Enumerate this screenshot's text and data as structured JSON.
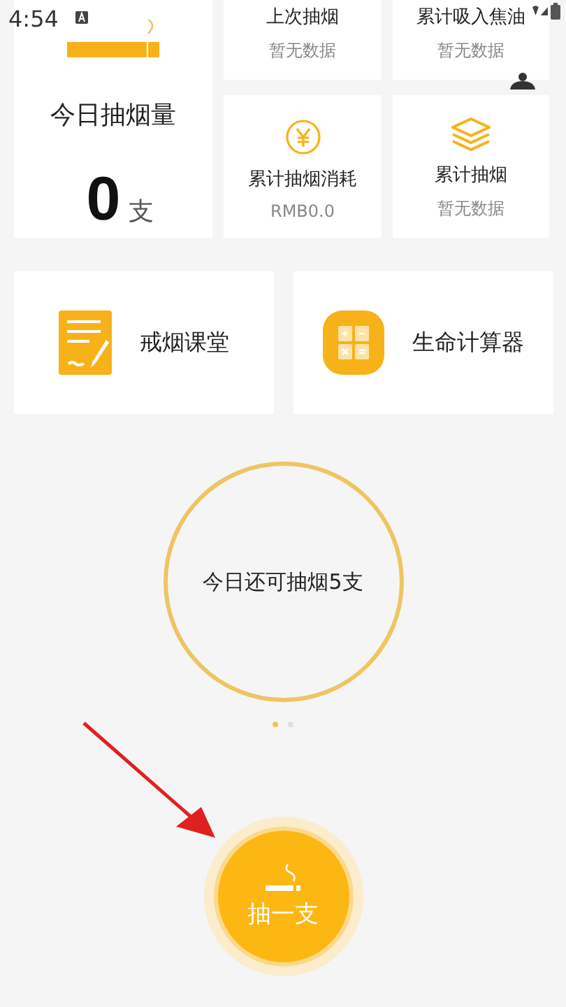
{
  "status_bar": {
    "time": "4:54"
  },
  "today": {
    "label": "今日抽烟量",
    "count": "0",
    "unit": "支"
  },
  "stats": [
    {
      "kind": "text",
      "title": "上次抽烟",
      "value": "暂无数据"
    },
    {
      "kind": "text",
      "title": "累计吸入焦油",
      "value": "暂无数据"
    },
    {
      "kind": "money",
      "title": "累计抽烟消耗",
      "value": "RMB0.0"
    },
    {
      "kind": "layers",
      "title": "累计抽烟",
      "value": "暂无数据"
    }
  ],
  "shortcuts": [
    {
      "kind": "notes",
      "label": "戒烟课堂"
    },
    {
      "kind": "calculator",
      "label": "生命计算器"
    }
  ],
  "remaining": {
    "text": "今日还可抽烟5支"
  },
  "pager": [
    {
      "selected": true
    },
    {
      "selected": false
    }
  ],
  "smoke_button": {
    "label": "抽一支"
  }
}
